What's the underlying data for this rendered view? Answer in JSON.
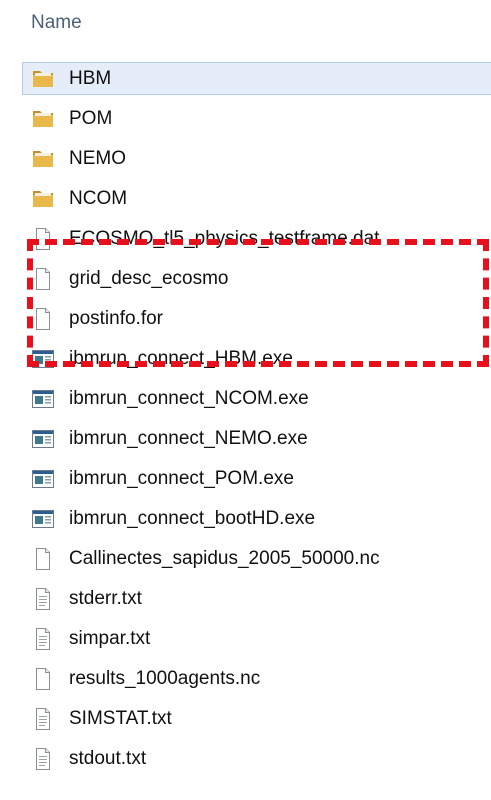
{
  "header": {
    "column_label": "Name"
  },
  "files": [
    {
      "name": "HBM",
      "type": "folder",
      "selected": true
    },
    {
      "name": "POM",
      "type": "folder"
    },
    {
      "name": "NEMO",
      "type": "folder"
    },
    {
      "name": "NCOM",
      "type": "folder"
    },
    {
      "name": "ECOSMO_tl5_physics_testframe.dat",
      "type": "file"
    },
    {
      "name": "grid_desc_ecosmo",
      "type": "file"
    },
    {
      "name": "postinfo.for",
      "type": "file"
    },
    {
      "name": "ibmrun_connect_HBM.exe",
      "type": "exe"
    },
    {
      "name": "ibmrun_connect_NCOM.exe",
      "type": "exe"
    },
    {
      "name": "ibmrun_connect_NEMO.exe",
      "type": "exe"
    },
    {
      "name": "ibmrun_connect_POM.exe",
      "type": "exe"
    },
    {
      "name": "ibmrun_connect_bootHD.exe",
      "type": "exe"
    },
    {
      "name": "Callinectes_sapidus_2005_50000.nc",
      "type": "file"
    },
    {
      "name": "stderr.txt",
      "type": "text"
    },
    {
      "name": "simpar.txt",
      "type": "text"
    },
    {
      "name": "results_1000agents.nc",
      "type": "file"
    },
    {
      "name": "SIMSTAT.txt",
      "type": "text"
    },
    {
      "name": "stdout.txt",
      "type": "text"
    }
  ],
  "colors": {
    "folder": "#e8b84a",
    "folder_dark": "#c8922a",
    "annotation": "#e8101c",
    "header_text": "#4c607a"
  }
}
